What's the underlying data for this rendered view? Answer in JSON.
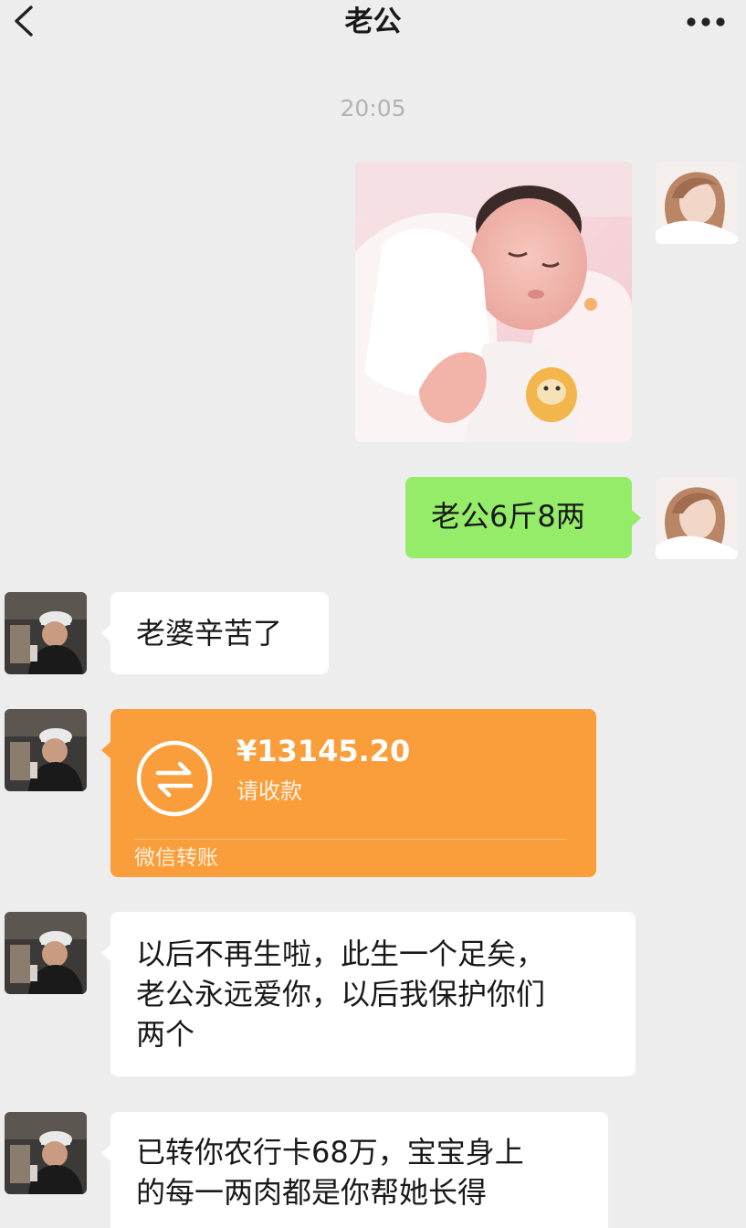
{
  "header": {
    "title": "老公"
  },
  "timestamp": "20:05",
  "messages": [
    {
      "sender": "me",
      "type": "image"
    },
    {
      "sender": "me",
      "type": "text",
      "text": "老公6斤8两"
    },
    {
      "sender": "husband",
      "type": "text",
      "text": "老婆辛苦了"
    },
    {
      "sender": "husband",
      "type": "transfer",
      "amount": "¥13145.20",
      "action": "请收款",
      "service": "微信转账"
    },
    {
      "sender": "husband",
      "type": "text",
      "lines": [
        "以后不再生啦，此生一个足矣，",
        "老公永远爱你，以后我保护你们",
        "两个"
      ]
    },
    {
      "sender": "husband",
      "type": "text",
      "lines": [
        "已转你农行卡68万，宝宝身上",
        "的每一两肉都是你帮她长得"
      ]
    }
  ],
  "colors": {
    "background": "#ededed",
    "sent_bubble": "#95ec69",
    "received_bubble": "#ffffff",
    "transfer_card": "#fa9d3b",
    "timestamp": "#b2b2b2"
  },
  "icons": {
    "back": "chevron-left-icon",
    "more": "more-dots-icon",
    "transfer": "transfer-arrows-icon"
  }
}
